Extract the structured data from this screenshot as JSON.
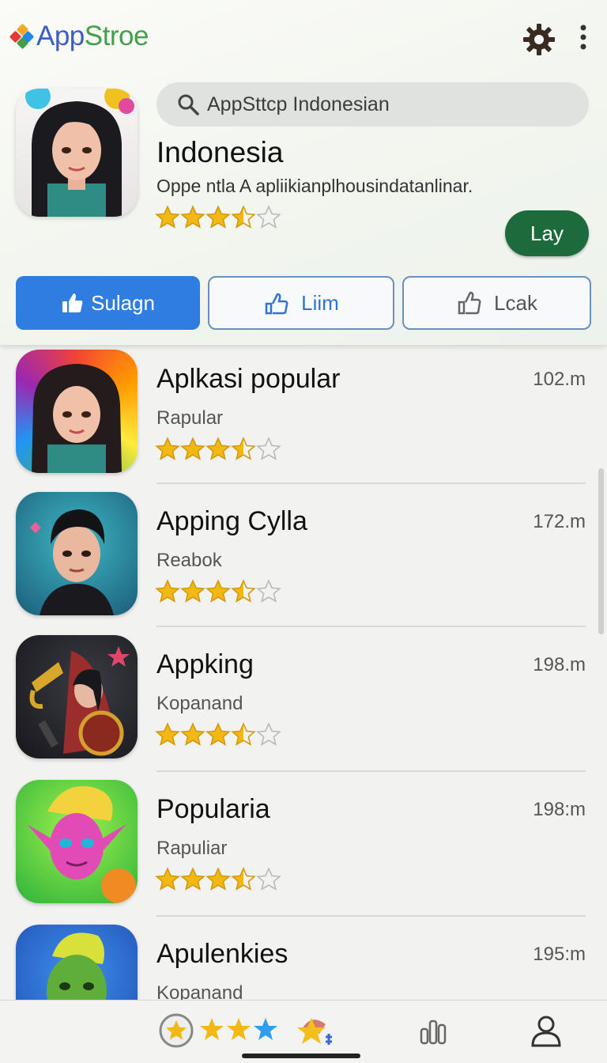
{
  "app": {
    "logo_part1": "App",
    "logo_part2": "Stroe"
  },
  "search": {
    "placeholder": "AppSttcp Indonesian"
  },
  "featured": {
    "title": "Indonesia",
    "description": "Oppe ntla A apliikianplhousindatanlinar.",
    "rating": 3.5,
    "action_label": "Lay",
    "action_color": "#1d6b3d"
  },
  "tabs": [
    {
      "label": "Sulagn",
      "icon": "thumbs-up-icon",
      "active": true
    },
    {
      "label": "Liim",
      "icon": "thumbs-up-outline-icon",
      "active": false
    },
    {
      "label": "Lcak",
      "icon": "thumbs-up-outline-icon",
      "active": false
    }
  ],
  "apps": [
    {
      "name": "Aplkasi popular",
      "category": "Rapular",
      "size": "102.m",
      "rating": 3.5,
      "icon": "avatar-woman-rainbow-icon"
    },
    {
      "name": "Apping Cylla",
      "category": "Reabok",
      "size": "172.m",
      "rating": 3.5,
      "icon": "avatar-man-teal-icon"
    },
    {
      "name": "Appking",
      "category": "Kopanand",
      "size": "198.m",
      "rating": 3.5,
      "icon": "game-warrior-icon"
    },
    {
      "name": "Popularia",
      "category": "Rapuliar",
      "size": "198:m",
      "rating": 3.5,
      "icon": "avatar-pink-elf-icon"
    },
    {
      "name": "Apulenkies",
      "category": "Kopanand",
      "size": "195:m",
      "rating": 3.5,
      "icon": "avatar-green-orc-icon"
    }
  ],
  "colors": {
    "accent": "#2f7de0",
    "star": "#f2b915",
    "logo_blue": "#3b5fc7",
    "logo_green": "#43a047"
  },
  "bottom_nav": [
    {
      "name": "rated-star-icon"
    },
    {
      "name": "stars-icon"
    },
    {
      "name": "featured-star-icon"
    },
    {
      "name": "charts-icon"
    },
    {
      "name": "profile-icon"
    }
  ]
}
